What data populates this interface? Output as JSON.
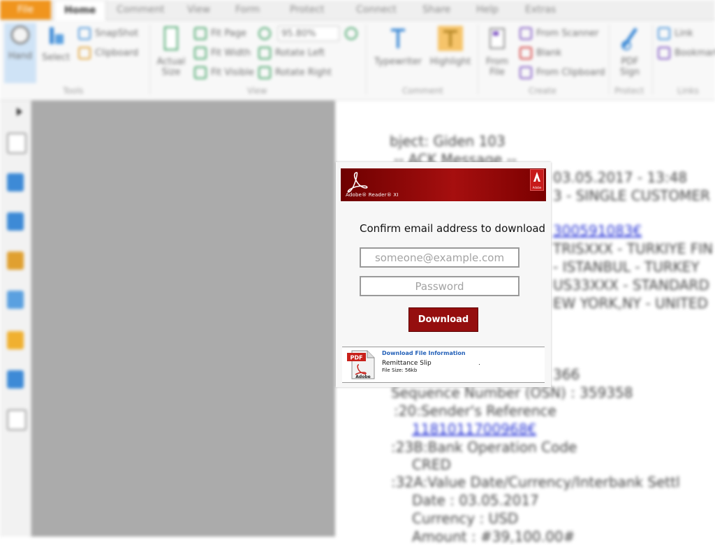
{
  "tabs": [
    "File",
    "Home",
    "Comment",
    "View",
    "Form",
    "Protect",
    "Connect",
    "Share",
    "Help",
    "Extras"
  ],
  "active_tab": "Home",
  "ribbon": {
    "tools": {
      "hand": "Hand",
      "select": "Select",
      "snapshot": "SnapShot",
      "clipboard": "Clipboard",
      "group": "Tools"
    },
    "view": {
      "actual_size": "Actual Size",
      "fit_page": "Fit Page",
      "fit_width": "Fit Width",
      "fit_visible": "Fit Visible",
      "zoom": "95.80%",
      "rotate_left": "Rotate Left",
      "rotate_right": "Rotate Right",
      "group": "View"
    },
    "comment": {
      "typewriter": "Typewriter",
      "highlight": "Highlight",
      "group": "Comment"
    },
    "create": {
      "from_file": "From File",
      "from_scanner": "From Scanner",
      "blank": "Blank",
      "from_clipboard": "From Clipboard",
      "group": "Create"
    },
    "protect": {
      "pdf_sign": "PDF Sign",
      "group": "Protect"
    },
    "links": {
      "link": "Link",
      "bookmark": "Bookmark",
      "group": "Links"
    }
  },
  "document_lines": [
    "bject: Giden 103",
    "-- ACK Message --",
    "03.05.2017 - 13:48",
    "3 - SINGLE CUSTOMER",
    "300591083€",
    "TRISXXX - TURKIYE FIN",
    "- ISTANBUL - TURKEY",
    "US33XXX - STANDARD",
    "EW YORK,NY - UNITED",
    "366",
    "Sequence Number (OSN) : 359358",
    ":20:Sender's Reference",
    "1181011700968€",
    ":23B:Bank Operation Code",
    "CRED",
    ":32A:Value Date/Currency/Interbank Settl",
    "Date          : 03.05.2017",
    "Currency        : USD",
    "Amount        : #39,100.00#"
  ],
  "dialog": {
    "brand": "Adobe® Reader® XI",
    "badge": "Adobe",
    "heading": "Confirm email address to download",
    "email_placeholder": "someone@example.com",
    "password_placeholder": "Password",
    "download_label": "Download",
    "file_info": {
      "pdf_label": "PDF",
      "adobe_label": "Adobe",
      "title": "Download File Information",
      "name": "Remittance Slip",
      "size": "File Size: 56kb"
    }
  },
  "colors": {
    "file_tab": "#f0951e",
    "banner_red": "#a60f0f",
    "download_button": "#950e0e",
    "link_blue": "#2360b8"
  }
}
